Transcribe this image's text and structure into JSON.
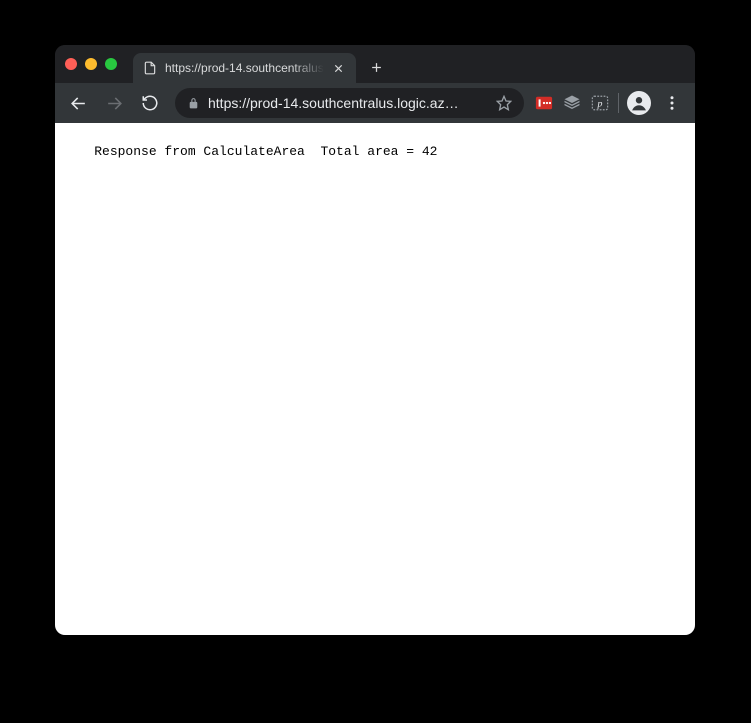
{
  "tab": {
    "title": "https://prod-14.southcentralus"
  },
  "address": {
    "url": "https://prod-14.southcentralus.logic.az…"
  },
  "page": {
    "body": "Response from CalculateArea  Total area = 42"
  }
}
